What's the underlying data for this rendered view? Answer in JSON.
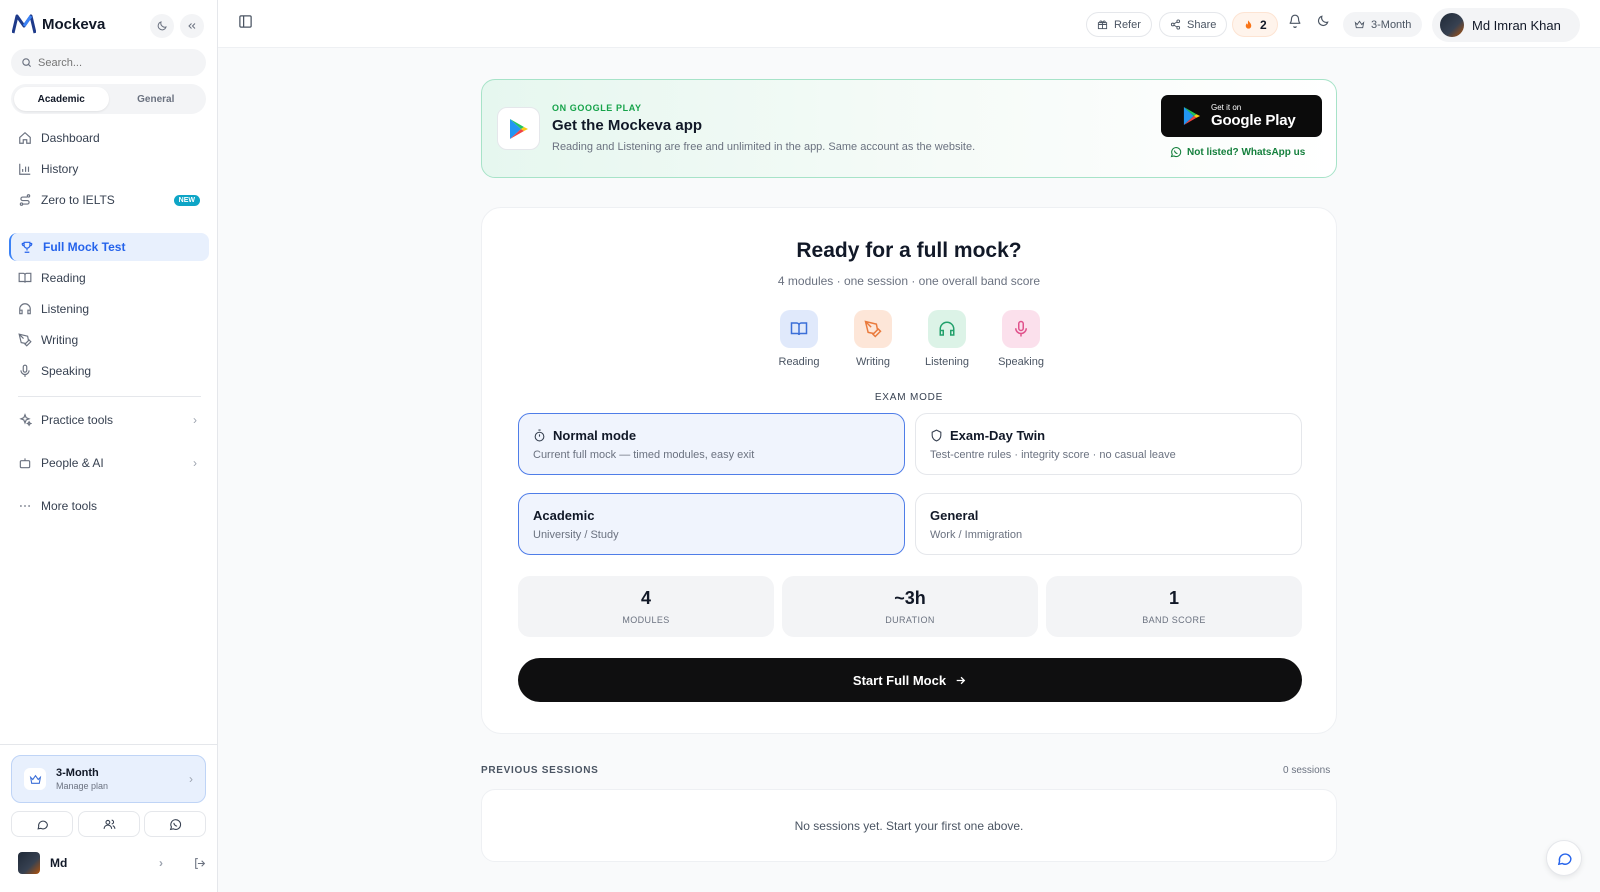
{
  "app": {
    "name": "Mockeva"
  },
  "sidebar": {
    "search_placeholder": "Search...",
    "segments": [
      {
        "label": "Academic",
        "active": true
      },
      {
        "label": "General",
        "active": false
      }
    ],
    "items": [
      {
        "label": "Dashboard",
        "icon": "home-icon"
      },
      {
        "label": "History",
        "icon": "bar-chart-icon"
      },
      {
        "label": "Zero to IELTS",
        "icon": "route-icon",
        "badge": "NEW"
      },
      {
        "label": "Full Mock Test",
        "icon": "trophy-icon",
        "active": true
      },
      {
        "label": "Reading",
        "icon": "book-icon"
      },
      {
        "label": "Listening",
        "icon": "headphones-icon"
      },
      {
        "label": "Writing",
        "icon": "pen-icon"
      },
      {
        "label": "Speaking",
        "icon": "mic-icon"
      },
      {
        "label": "Practice tools",
        "icon": "sparkles-icon"
      },
      {
        "label": "People & AI",
        "icon": "bot-icon"
      },
      {
        "label": "More tools",
        "icon": "more-icon"
      }
    ],
    "plan": {
      "title": "3-Month",
      "subtitle": "Manage plan"
    },
    "user": {
      "name": "Md"
    }
  },
  "topbar": {
    "refer": "Refer",
    "share": "Share",
    "streak": "2",
    "plan": "3-Month",
    "user_name": "Md Imran Khan"
  },
  "banner": {
    "eyebrow": "ON GOOGLE PLAY",
    "title": "Get the Mockeva app",
    "subtitle": "Reading and Listening are free and unlimited in the app. Same account as the website.",
    "store_small": "Get it on",
    "store_big": "Google Play",
    "whatsapp": "Not listed? WhatsApp us"
  },
  "mock": {
    "title": "Ready for a full mock?",
    "subtitle": "4 modules · one session · one overall band score",
    "modules": [
      {
        "label": "Reading",
        "icon": "book-icon",
        "bg": "#e0e9fb",
        "fg": "#3b6fd8"
      },
      {
        "label": "Writing",
        "icon": "pen-icon",
        "bg": "#fde6d8",
        "fg": "#ea7a3c"
      },
      {
        "label": "Listening",
        "icon": "headphones-icon",
        "bg": "#dcf3e7",
        "fg": "#22a06b"
      },
      {
        "label": "Speaking",
        "icon": "mic-icon",
        "bg": "#fbe0ec",
        "fg": "#e0528c"
      }
    ],
    "exam_mode_label": "EXAM MODE",
    "modes": [
      {
        "title": "Normal mode",
        "subtitle": "Current full mock — timed modules, easy exit",
        "selected": true
      },
      {
        "title": "Exam-Day Twin",
        "subtitle": "Test-centre rules · integrity score · no casual leave",
        "selected": false
      }
    ],
    "tracks": [
      {
        "title": "Academic",
        "subtitle": "University / Study",
        "selected": true
      },
      {
        "title": "General",
        "subtitle": "Work / Immigration",
        "selected": false
      }
    ],
    "stats": [
      {
        "value": "4",
        "label": "MODULES"
      },
      {
        "value": "~3h",
        "label": "DURATION"
      },
      {
        "value": "1",
        "label": "BAND SCORE"
      }
    ],
    "cta": "Start Full Mock"
  },
  "previous": {
    "label": "PREVIOUS SESSIONS",
    "count": "0 sessions",
    "empty": "No sessions yet. Start your first one above."
  },
  "colors": {
    "accent": "#2563eb",
    "brand_green": "#16a34a",
    "cta": "#0f0f10"
  }
}
